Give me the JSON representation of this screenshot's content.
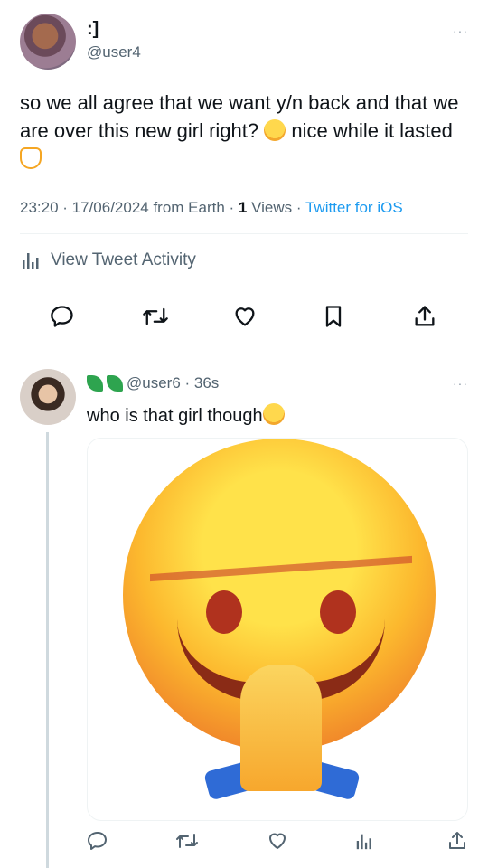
{
  "tweet": {
    "display_name": ":]",
    "handle": "@user4",
    "more": "···",
    "text_part1": "so we all agree that we want y/n back and that we are over this new girl right? ",
    "text_part2": " nice while it lasted ",
    "timestamp": "23:20 · 17/06/2024 from Earth · ",
    "views_count": "1",
    "views_label": " Views · ",
    "source": "Twitter for iOS",
    "activity_label": "View Tweet Activity"
  },
  "reply": {
    "handle": "@user6 · 36s",
    "more": "···",
    "text": "who is that girl though"
  },
  "colors": {
    "accent": "#1d9bf0",
    "muted": "#536471",
    "divider": "#eff3f4"
  },
  "icons": {
    "tweet_actions": [
      "reply-icon",
      "retweet-icon",
      "like-icon",
      "bookmark-icon",
      "share-icon"
    ],
    "reply_actions": [
      "reply-icon",
      "retweet-icon",
      "like-icon",
      "views-icon",
      "share-icon"
    ]
  }
}
